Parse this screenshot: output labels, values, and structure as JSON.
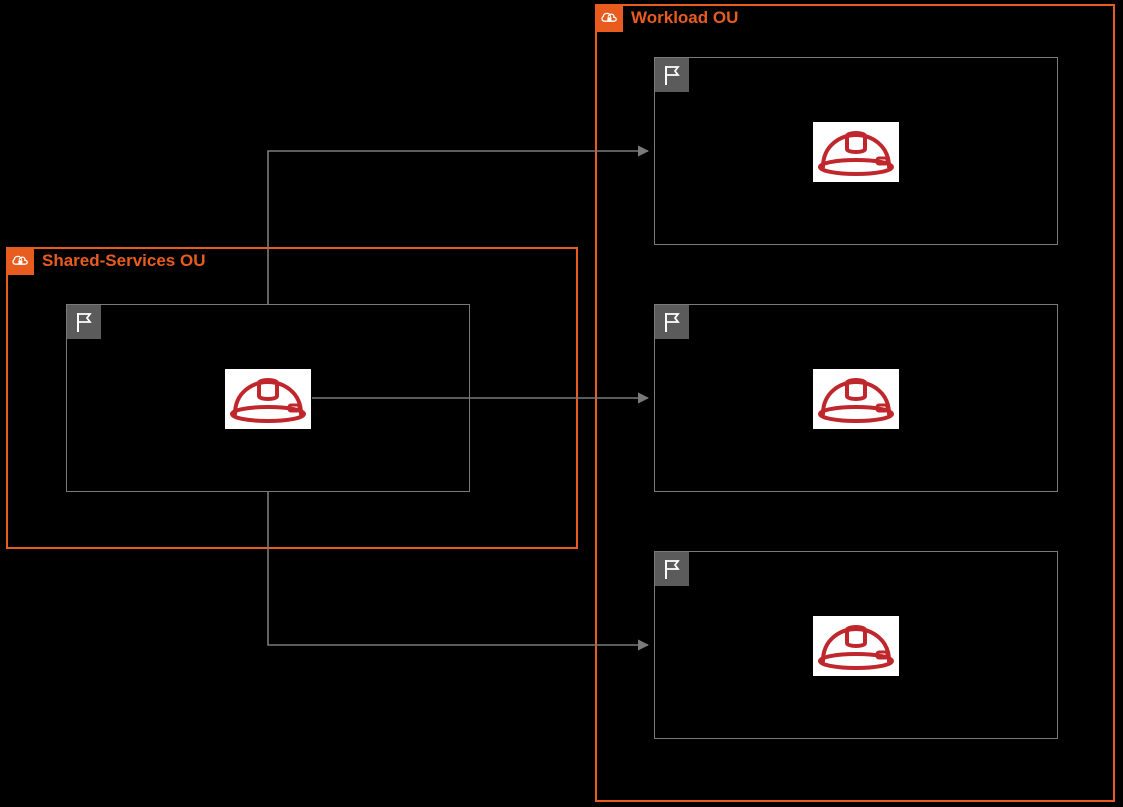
{
  "diagram": {
    "shared_ou": {
      "title": "Shared-Services OU"
    },
    "workload_ou": {
      "title": "Workload OU"
    }
  }
}
